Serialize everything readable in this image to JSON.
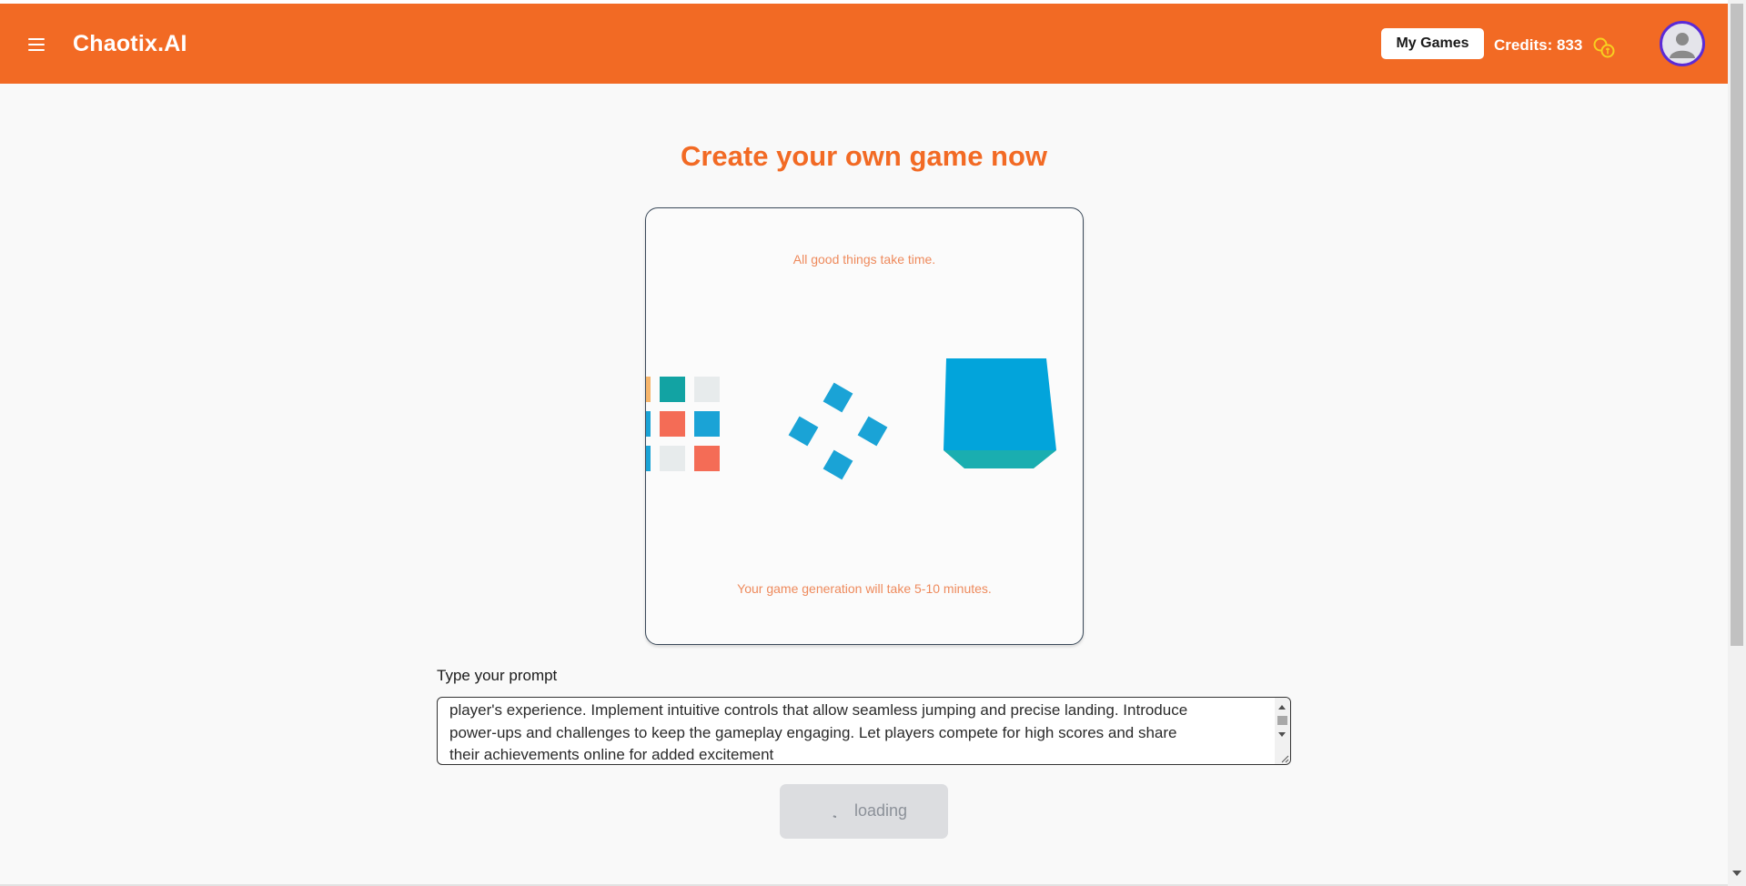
{
  "header": {
    "brand": "Chaotix.AI",
    "my_games_label": "My Games",
    "credits_text": "Credits: 833",
    "accent_color": "#f26a24",
    "icons": {
      "menu": "hamburger-menu-icon",
      "coins": "coins-icon",
      "avatar": "user-avatar-icon"
    }
  },
  "main": {
    "title": "Create your own game now",
    "loader": {
      "top_message": "All good things take time.",
      "bottom_message": "Your game generation will take 5-10 minutes."
    },
    "prompt": {
      "label": "Type your prompt",
      "value": "player's experience. Implement intuitive controls that allow seamless jumping and precise landing. Introduce\npower-ups and challenges to keep the gameplay engaging. Let players compete for high scores and share\ntheir achievements online for added excitement"
    },
    "submit": {
      "label": "loading",
      "state": "disabled"
    }
  }
}
